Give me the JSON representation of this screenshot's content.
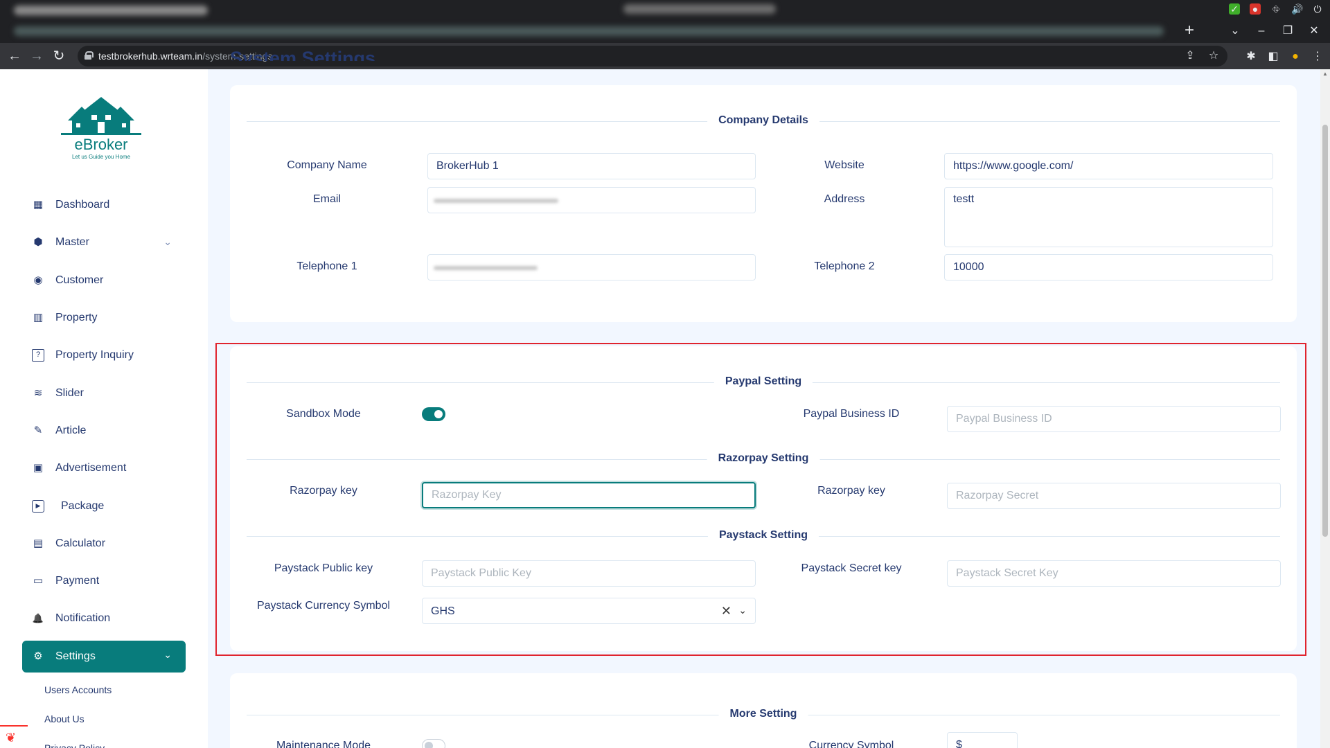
{
  "browser": {
    "url_host": "testbrokerhub.wrteam.in",
    "url_path": "/system-settings",
    "nav": {
      "back": "←",
      "forward": "→",
      "reload": "↻"
    }
  },
  "sidebar": {
    "brand": "eBroker",
    "tagline": "Let us Guide you Home",
    "items": [
      {
        "label": "Dashboard",
        "icon": "▦"
      },
      {
        "label": "Master",
        "icon": "⬢",
        "chevron": "⌄"
      },
      {
        "label": "Customer",
        "icon": "◉"
      },
      {
        "label": "Property",
        "icon": "▥"
      },
      {
        "label": "Property Inquiry",
        "icon": "?"
      },
      {
        "label": "Slider",
        "icon": "≋"
      },
      {
        "label": "Article",
        "icon": "✎"
      },
      {
        "label": "Advertisement",
        "icon": "▣"
      },
      {
        "label": "Package",
        "icon": "▶"
      },
      {
        "label": "Calculator",
        "icon": "▤"
      },
      {
        "label": "Payment",
        "icon": "▭"
      },
      {
        "label": "Notification",
        "icon": "🔔"
      },
      {
        "label": "Settings",
        "icon": "⚙",
        "chevron": "⌄",
        "active": true
      }
    ],
    "subitems": [
      "Users Accounts",
      "About Us",
      "Privacy Policy"
    ]
  },
  "page": {
    "title": "System Settings"
  },
  "company": {
    "section_title": "Company Details",
    "company_name_label": "Company Name",
    "company_name_value": "BrokerHub 1",
    "website_label": "Website",
    "website_value": "https://www.google.com/",
    "email_label": "Email",
    "address_label": "Address",
    "address_value": "testt",
    "telephone1_label": "Telephone 1",
    "telephone2_label": "Telephone 2",
    "telephone2_value": "10000"
  },
  "payment": {
    "paypal_title": "Paypal Setting",
    "sandbox_label": "Sandbox Mode",
    "sandbox_on": true,
    "paypal_business_label": "Paypal Business ID",
    "paypal_business_placeholder": "Paypal Business ID",
    "razorpay_title": "Razorpay Setting",
    "razorpay_key_label": "Razorpay key",
    "razorpay_key_placeholder": "Razorpay Key",
    "razorpay_secret_label": "Razorpay key",
    "razorpay_secret_placeholder": "Razorpay Secret",
    "paystack_title": "Paystack Setting",
    "paystack_public_label": "Paystack Public key",
    "paystack_public_placeholder": "Paystack Public Key",
    "paystack_secret_label": "Paystack Secret key",
    "paystack_secret_placeholder": "Paystack Secret Key",
    "paystack_currency_label": "Paystack Currency Symbol",
    "paystack_currency_value": "GHS"
  },
  "more": {
    "section_title": "More Setting",
    "maintenance_label": "Maintenance Mode",
    "maintenance_on": false,
    "currency_symbol_label": "Currency Symbol",
    "currency_symbol_value": "$"
  },
  "colors": {
    "accent": "#087c7c",
    "highlight": "#e0242e",
    "text": "#25396f"
  }
}
